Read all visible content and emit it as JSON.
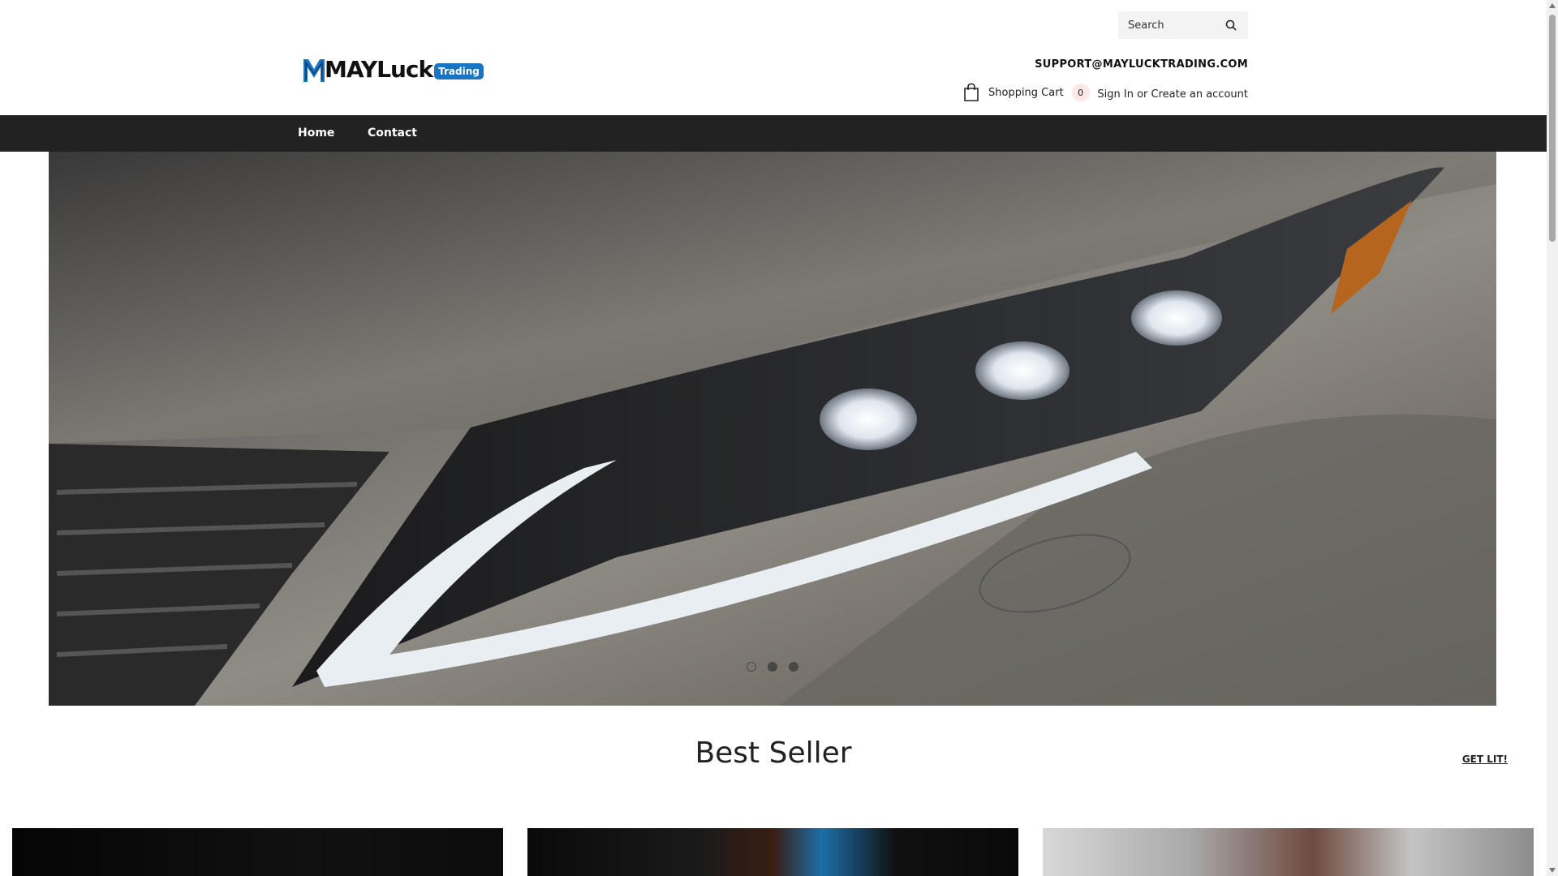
{
  "header": {
    "search": {
      "placeholder": "Search",
      "icon": "search-icon"
    },
    "logo": {
      "word": "MAYLuck",
      "badge": "Trading",
      "badge_color": "#1a74c4"
    },
    "support_email": "SUPPORT@MAYLUCKTRADING.COM",
    "cart": {
      "label": "Shopping Cart",
      "count": "0",
      "icon": "shopping-bag-icon"
    },
    "account": {
      "sign_in": "Sign In",
      "separator": "or",
      "create": "Create an account"
    }
  },
  "nav": {
    "background": "#222222",
    "items": [
      {
        "label": "Home"
      },
      {
        "label": "Contact"
      }
    ]
  },
  "hero": {
    "slides_total": 3,
    "active_slide": 1
  },
  "best_seller": {
    "title": "Best Seller",
    "link": "GET LIT!"
  }
}
